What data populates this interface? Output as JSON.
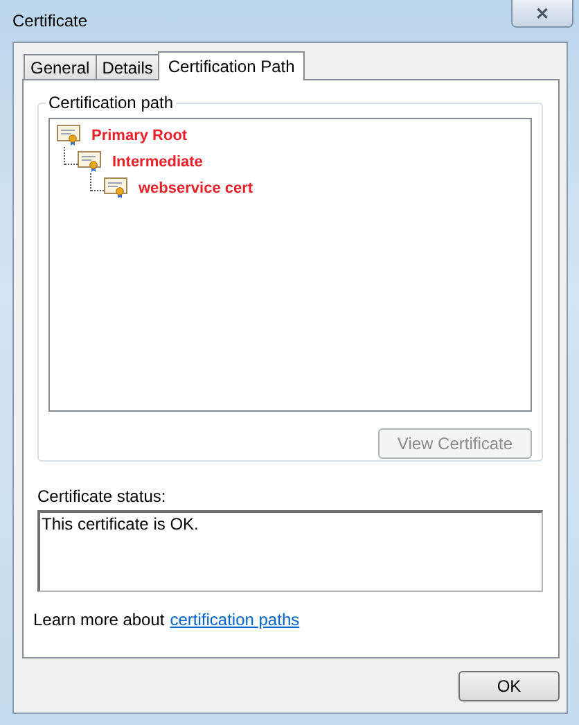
{
  "window": {
    "title": "Certificate",
    "close": "✕"
  },
  "tabs": [
    {
      "label": "General",
      "selected": false
    },
    {
      "label": "Details",
      "selected": false
    },
    {
      "label": "Certification Path",
      "selected": true
    }
  ],
  "certification_path": {
    "title": "Certification path",
    "tree": [
      {
        "label": "Primary Root",
        "children": [
          {
            "label": "Intermediate",
            "children": [
              {
                "label": "webservice cert"
              }
            ]
          }
        ]
      }
    ],
    "view_button": {
      "label": "View Certificate",
      "disabled": true
    }
  },
  "status": {
    "label": "Certificate status:",
    "value": "This certificate is OK."
  },
  "learn_more": {
    "text": "Learn more about",
    "link": "certification paths"
  },
  "buttons": [
    {
      "label": "OK"
    }
  ]
}
